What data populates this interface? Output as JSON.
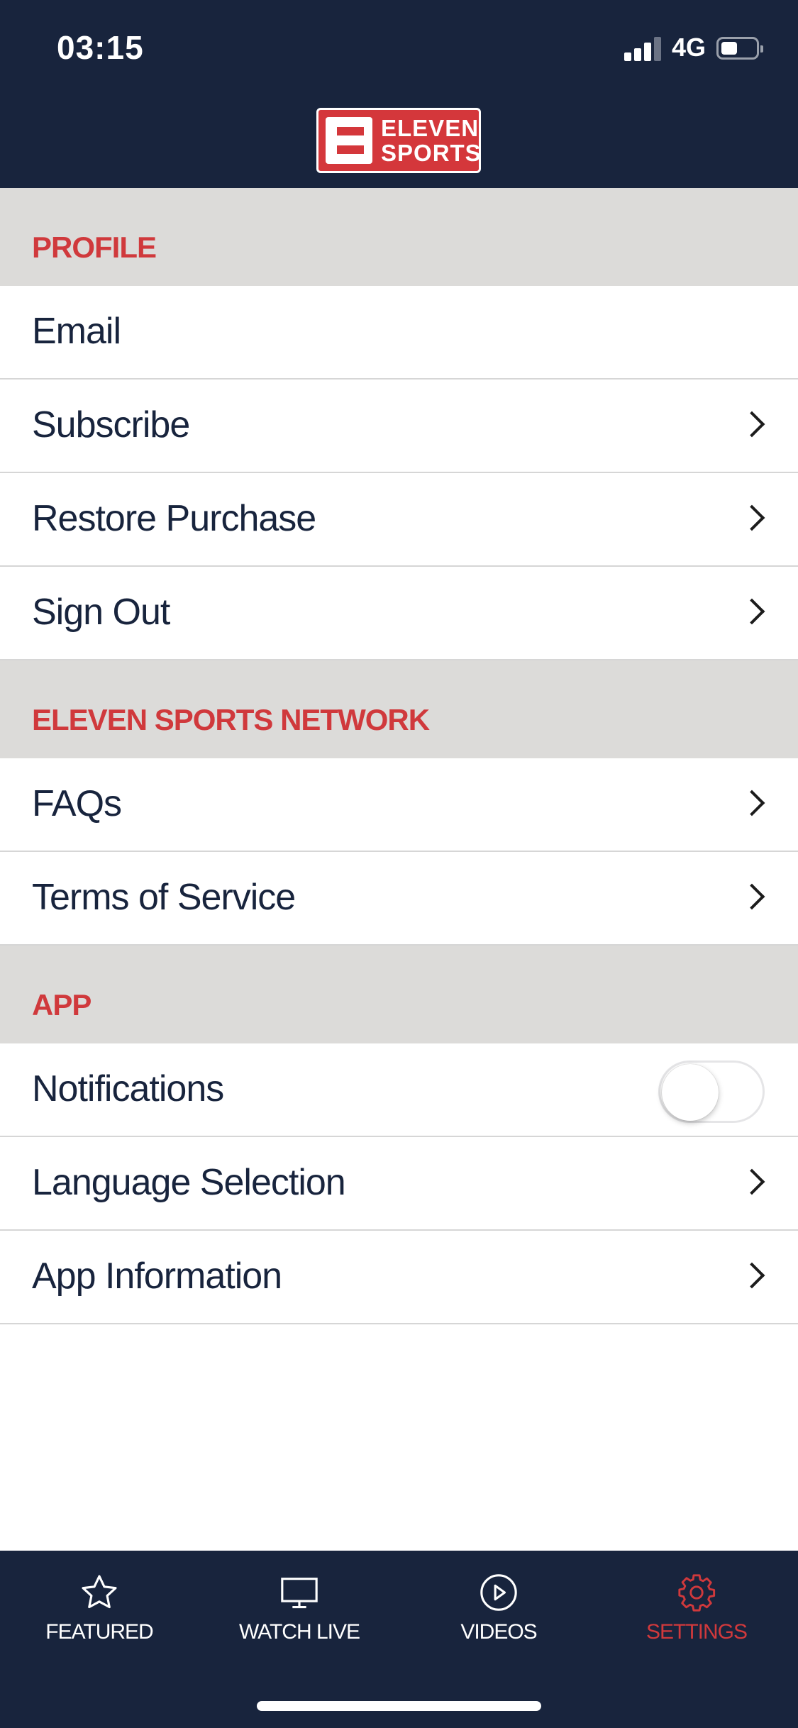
{
  "status_bar": {
    "time": "03:15",
    "network": "4G"
  },
  "header": {
    "logo_line1": "ELEVEN",
    "logo_line2": "SPORTS"
  },
  "sections": {
    "profile": {
      "title": "PROFILE",
      "items": [
        "Email",
        "Subscribe",
        "Restore Purchase",
        "Sign Out"
      ]
    },
    "network": {
      "title": "ELEVEN SPORTS NETWORK",
      "items": [
        "FAQs",
        "Terms of Service"
      ]
    },
    "app": {
      "title": "APP",
      "items": [
        "Notifications",
        "Language Selection",
        "App Information"
      ],
      "notifications_enabled": false
    }
  },
  "tabbar": {
    "tabs": [
      {
        "label": "FEATURED",
        "icon": "star-icon"
      },
      {
        "label": "WATCH LIVE",
        "icon": "monitor-icon"
      },
      {
        "label": "VIDEOS",
        "icon": "play-circle-icon"
      },
      {
        "label": "SETTINGS",
        "icon": "gear-icon"
      }
    ],
    "active_index": 3
  },
  "colors": {
    "navy": "#18243d",
    "accent_red": "#d0393c",
    "section_gray": "#dcdbd9"
  }
}
